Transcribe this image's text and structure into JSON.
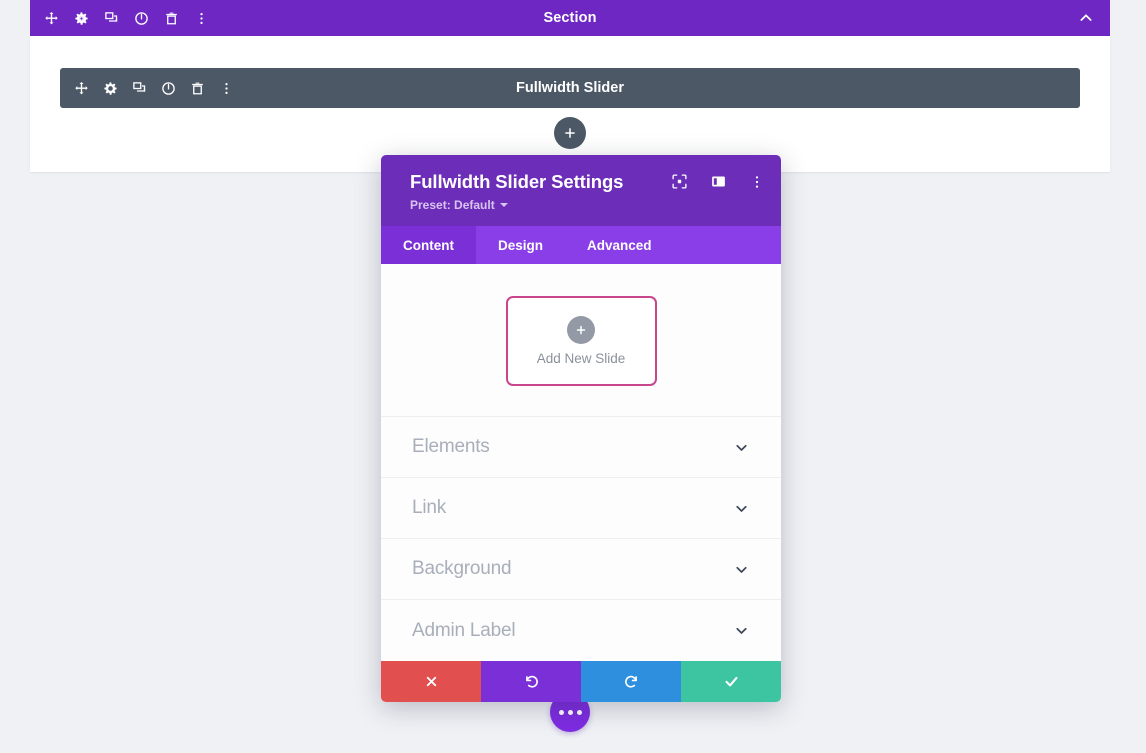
{
  "section": {
    "title": "Section",
    "tools": [
      {
        "name": "move-icon",
        "label": "Move"
      },
      {
        "name": "gear-icon",
        "label": "Settings"
      },
      {
        "name": "duplicate-icon",
        "label": "Duplicate"
      },
      {
        "name": "power-icon",
        "label": "Disable"
      },
      {
        "name": "trash-icon",
        "label": "Delete"
      },
      {
        "name": "more-vertical-icon",
        "label": "More Options"
      }
    ],
    "collapse_icon": "chevron-up-icon",
    "bar_color": "#6f27c4"
  },
  "module": {
    "title": "Fullwidth Slider",
    "tools": [
      {
        "name": "move-icon",
        "label": "Move"
      },
      {
        "name": "gear-icon",
        "label": "Settings"
      },
      {
        "name": "duplicate-icon",
        "label": "Duplicate"
      },
      {
        "name": "power-icon",
        "label": "Disable"
      },
      {
        "name": "trash-icon",
        "label": "Delete"
      },
      {
        "name": "more-vertical-icon",
        "label": "More Options"
      }
    ],
    "bar_color": "#4c5866"
  },
  "add_module_button": {
    "icon": "plus-icon",
    "label": "Add New Module",
    "color": "#4c5866"
  },
  "modal": {
    "title": "Fullwidth Slider Settings",
    "preset_label": "Preset: Default",
    "header_color": "#6c2eb9",
    "header_icons": [
      {
        "name": "focus-target-icon",
        "label": "Focus"
      },
      {
        "name": "panel-layout-icon",
        "label": "Panel Layout"
      },
      {
        "name": "more-vertical-icon",
        "label": "More Options"
      }
    ],
    "tabs": [
      {
        "label": "Content",
        "active": true
      },
      {
        "label": "Design",
        "active": false
      },
      {
        "label": "Advanced",
        "active": false
      }
    ],
    "add_slide": {
      "label": "Add New Slide",
      "icon": "plus-icon",
      "border_color": "#c8468c"
    },
    "sections": [
      {
        "label": "Elements",
        "icon": "chevron-down-icon"
      },
      {
        "label": "Link",
        "icon": "chevron-down-icon"
      },
      {
        "label": "Background",
        "icon": "chevron-down-icon"
      },
      {
        "label": "Admin Label",
        "icon": "chevron-down-icon"
      }
    ],
    "footer_buttons": [
      {
        "name": "cancel-button",
        "icon": "close-x-icon",
        "label": "Cancel",
        "color": "#e24f4f"
      },
      {
        "name": "undo-button",
        "icon": "undo-arrow-icon",
        "label": "Undo",
        "color": "#7b2fd6"
      },
      {
        "name": "redo-button",
        "icon": "redo-arrow-icon",
        "label": "Redo",
        "color": "#2d8fdd"
      },
      {
        "name": "save-button",
        "icon": "checkmark-icon",
        "label": "Save Changes",
        "color": "#3dc4a0"
      }
    ]
  },
  "floating_button": {
    "icon": "three-dots-icon",
    "label": "Builder Menu",
    "color": "#7d2ce0"
  },
  "page": {
    "background_color": "#eff1f5",
    "canvas_color": "#ffffff"
  }
}
